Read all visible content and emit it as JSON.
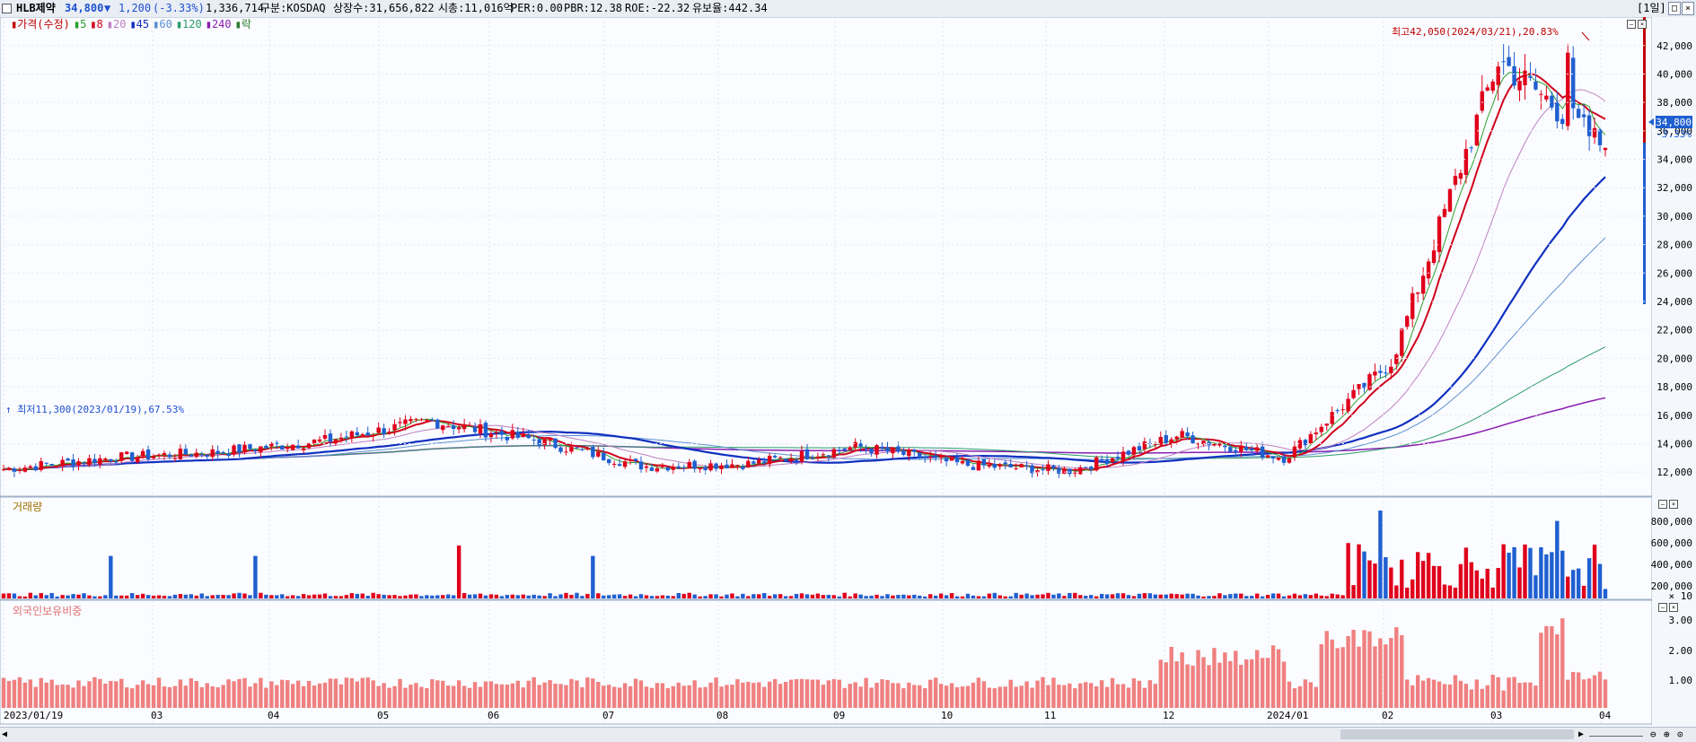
{
  "header": {
    "stock_name": "HLB제약",
    "price": "34,800",
    "change_arrow": "▼",
    "change": "1,200",
    "change_pct": "(-3.33%)",
    "volume": "1,336,714",
    "market": "구분:KOSDAQ",
    "shares": "상장수:31,656,822",
    "market_cap": "시총:11,016억",
    "per": "PER:0.00",
    "pbr": "PBR:12.38",
    "roe": "ROE:-22.32",
    "reserve": "유보율:442.34",
    "period": "[1일]"
  },
  "price_panel": {
    "legend": [
      {
        "label": "가격(수정)",
        "color": "#c00000"
      },
      {
        "label": "5",
        "color": "#2ca02c"
      },
      {
        "label": "8",
        "color": "#d0021b"
      },
      {
        "label": "20",
        "color": "#c080c0"
      },
      {
        "label": "45",
        "color": "#1030c0"
      },
      {
        "label": "60",
        "color": "#5a8fd0"
      },
      {
        "label": "120",
        "color": "#2e9c6a"
      },
      {
        "label": "240",
        "color": "#8a1fb0"
      },
      {
        "label": "락",
        "color": "#2e7d32"
      }
    ],
    "high_note": "최고42,050(2024/03/21),20.83%",
    "low_note": "최저11,300(2023/01/19),67.53%",
    "current_tag": "34,800",
    "current_pct": "-3.33%",
    "y_ticks": [
      "42,000",
      "40,000",
      "38,000",
      "36,000",
      "34,000",
      "32,000",
      "30,000",
      "28,000",
      "26,000",
      "24,000",
      "22,000",
      "20,000",
      "18,000",
      "16,000",
      "14,000",
      "12,000"
    ]
  },
  "volume_panel": {
    "title": "거래량",
    "y_ticks": [
      "800,000",
      "600,000",
      "400,000",
      "200,000"
    ],
    "unit": "× 10"
  },
  "foreign_panel": {
    "title": "외국인보유비중",
    "y_ticks": [
      "3.00",
      "2.00",
      "1.00"
    ]
  },
  "x_axis": [
    "2023/01/19",
    "03",
    "04",
    "05",
    "06",
    "07",
    "08",
    "09",
    "10",
    "11",
    "12",
    "2024/01",
    "02",
    "03",
    "04"
  ],
  "colors": {
    "up": "#e0001b",
    "down": "#1f5fd0",
    "foreign": "#f08080"
  },
  "chart_data": {
    "type": "candlestick",
    "title": "HLB제약",
    "months": [
      "2023/01/19",
      "03",
      "04",
      "05",
      "06",
      "07",
      "08",
      "09",
      "10",
      "11",
      "12",
      "2024/01",
      "02",
      "03",
      "04"
    ],
    "close_path": [
      [
        "2023/01",
        12200
      ],
      [
        "2023/02",
        13000
      ],
      [
        "2023/03",
        13400
      ],
      [
        "2023/04",
        14200
      ],
      [
        "2023/05",
        15600
      ],
      [
        "2023/06",
        14200
      ],
      [
        "2023/07",
        12400
      ],
      [
        "2023/08",
        12600
      ],
      [
        "2023/09",
        13800
      ],
      [
        "2023/10",
        12500
      ],
      [
        "2023/11",
        12100
      ],
      [
        "2023/12",
        14600
      ],
      [
        "2024/01",
        13000
      ],
      [
        "2024/02",
        19800
      ],
      [
        "2024/03",
        41000
      ],
      [
        "2024/04",
        34800
      ]
    ],
    "high": {
      "value": 42050,
      "date": "2024/03/21"
    },
    "low": {
      "value": 11300,
      "date": "2023/01/19"
    },
    "ylim": [
      11000,
      43500
    ]
  }
}
